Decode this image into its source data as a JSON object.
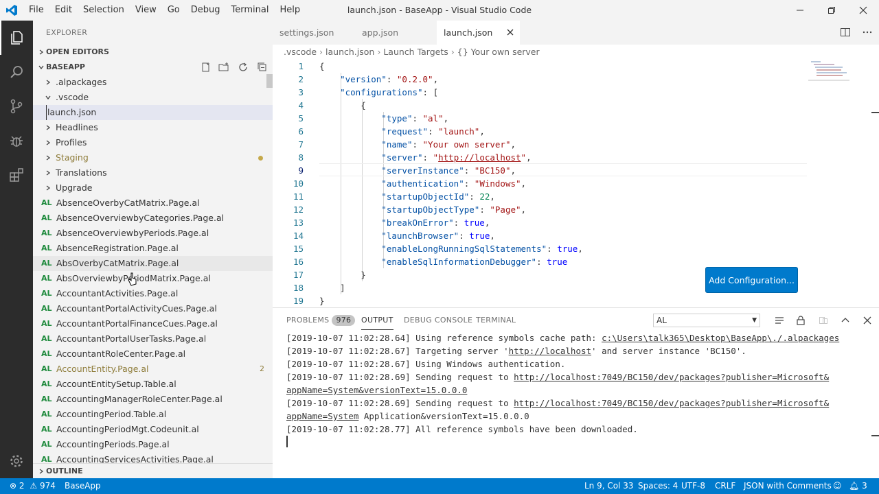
{
  "titlebar": {
    "menus": [
      "File",
      "Edit",
      "Selection",
      "View",
      "Go",
      "Debug",
      "Terminal",
      "Help"
    ],
    "title": "launch.json - BaseApp - Visual Studio Code"
  },
  "colors": {
    "accent": "#007acc",
    "activity_bar": "#2c2c2c",
    "sidebar": "#f3f3f3"
  },
  "activity": [
    "explorer-icon",
    "search-icon",
    "source-control-icon",
    "debug-icon",
    "extensions-icon",
    "settings-gear-icon"
  ],
  "sidebar": {
    "title": "EXPLORER",
    "open_editors": "OPEN EDITORS",
    "root": "BASEAPP",
    "outline": "OUTLINE",
    "folders": [
      {
        "label": ".alpackages",
        "state": "collapsed"
      },
      {
        "label": ".vscode",
        "state": "expanded"
      }
    ],
    "vscode_child": "launch.json",
    "folders2": [
      {
        "label": "Headlines"
      },
      {
        "label": "Profiles"
      },
      {
        "label": "Staging"
      },
      {
        "label": "Translations"
      },
      {
        "label": "Upgrade"
      }
    ],
    "al_tag": "AL",
    "files": [
      "AbsenceOverbyCatMatrix.Page.al",
      "AbsenceOverviewbyCategories.Page.al",
      "AbsenceOverviewbyPeriods.Page.al",
      "AbsenceRegistration.Page.al",
      "AbsOverbyCatMatrix.Page.al",
      "AbsOverviewbyPeriodMatrix.Page.al",
      "AccountantActivities.Page.al",
      "AccountantPortalActivityCues.Page.al",
      "AccountantPortalFinanceCues.Page.al",
      "AccountantPortalUserTasks.Page.al",
      "AccountantRoleCenter.Page.al",
      "AccountEntity.Page.al",
      "AccountEntitySetup.Table.al",
      "AccountingManagerRoleCenter.Page.al",
      "AccountingPeriod.Table.al",
      "AccountingPeriodMgt.Codeunit.al",
      "AccountingPeriods.Page.al",
      "AccountingServicesActivities.Page.al"
    ],
    "accountentity_badge": "2"
  },
  "tabs": [
    "settings.json",
    "app.json",
    "launch.json"
  ],
  "breadcrumb": [
    ".vscode",
    "launch.json",
    "Launch Targets",
    "{} Your own server"
  ],
  "editor": {
    "line_numbers": [
      "1",
      "2",
      "3",
      "4",
      "5",
      "6",
      "7",
      "8",
      "9",
      "10",
      "11",
      "12",
      "13",
      "14",
      "15",
      "16",
      "17",
      "18",
      "19"
    ],
    "add_configuration": "Add Configuration..."
  },
  "panel": {
    "tabs": [
      "PROBLEMS",
      "OUTPUT",
      "DEBUG CONSOLE",
      "TERMINAL"
    ],
    "problems_count": "976",
    "channel": "AL",
    "output": [
      "[2019-10-07 11:02:28.64] Using reference symbols cache path: ",
      "c:\\Users\\talk365\\Desktop\\BaseApp\\./.alpackages",
      "[2019-10-07 11:02:28.67] Targeting server '",
      "http://localhost",
      "' and server instance 'BC150'.",
      "[2019-10-07 11:02:28.67] Using Windows authentication.",
      "[2019-10-07 11:02:28.69] Sending request to ",
      "http://localhost:7049/BC150/dev/packages?publisher=Microsoft&",
      "appName=System&versionText=15.0.0.0",
      "[2019-10-07 11:02:28.69] Sending request to ",
      "http://localhost:7049/BC150/dev/packages?publisher=Microsoft&",
      "appName=System",
      " Application&versionText=15.0.0.0",
      "[2019-10-07 11:02:28.77] All reference symbols have been downloaded."
    ]
  },
  "statusbar": {
    "errors": "2",
    "warnings": "974",
    "project": "BaseApp",
    "position": "Ln 9, Col 33",
    "spaces": "Spaces: 4",
    "encoding": "UTF-8",
    "eol": "CRLF",
    "language": "JSON with Comments",
    "notifications": "3"
  }
}
